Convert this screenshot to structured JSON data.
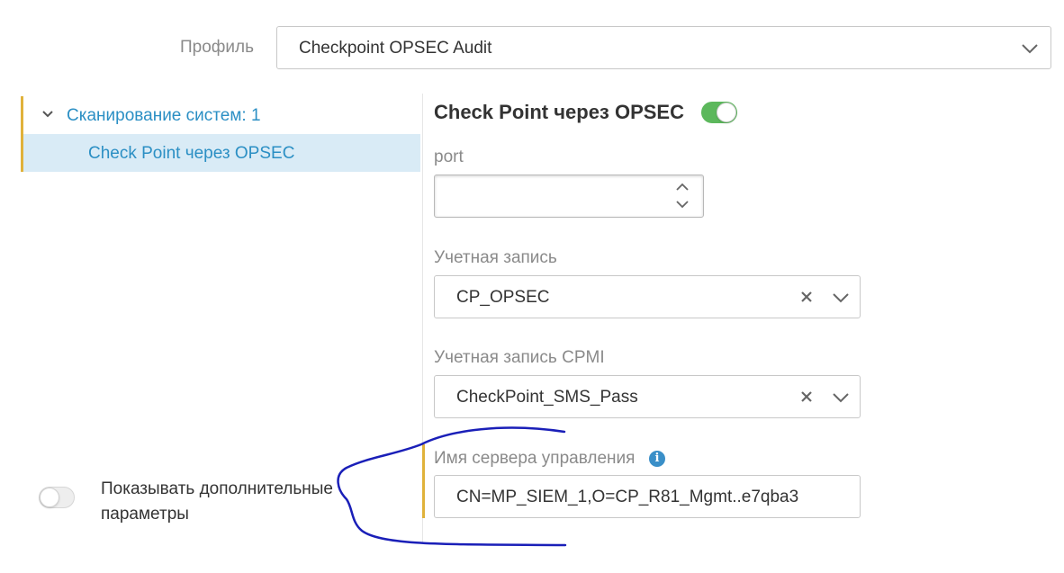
{
  "profile": {
    "label": "Профиль",
    "selected": "Checkpoint OPSEC Audit"
  },
  "tree": {
    "group_label": "Сканирование систем: 1",
    "items": [
      {
        "label": "Check Point через OPSEC"
      }
    ]
  },
  "section": {
    "title": "Check Point через OPSEC",
    "enabled": true
  },
  "fields": {
    "port": {
      "label": "port",
      "value": ""
    },
    "account": {
      "label": "Учетная запись",
      "value": "CP_OPSEC"
    },
    "account_cpmi": {
      "label": "Учетная запись CPMI",
      "value": "CheckPoint_SMS_Pass"
    },
    "server_name": {
      "label": "Имя сервера управления",
      "value": "CN=MP_SIEM_1,O=CP_R81_Mgmt..e7qba3"
    }
  },
  "extra_params": {
    "label": "Показывать дополнительные параметры",
    "enabled": false
  },
  "icons": {
    "chevron": "chevron-down-icon",
    "clear": "clear-icon",
    "info": "info-icon",
    "spin_up": "chevron-up-icon",
    "spin_down": "chevron-down-icon"
  },
  "colors": {
    "accent_blue": "#2b8fc4",
    "toggle_on": "#5cb85c",
    "marker": "#e0b23b",
    "selected_row": "#d9ebf6",
    "annotation_ink": "#1a1fb8"
  }
}
